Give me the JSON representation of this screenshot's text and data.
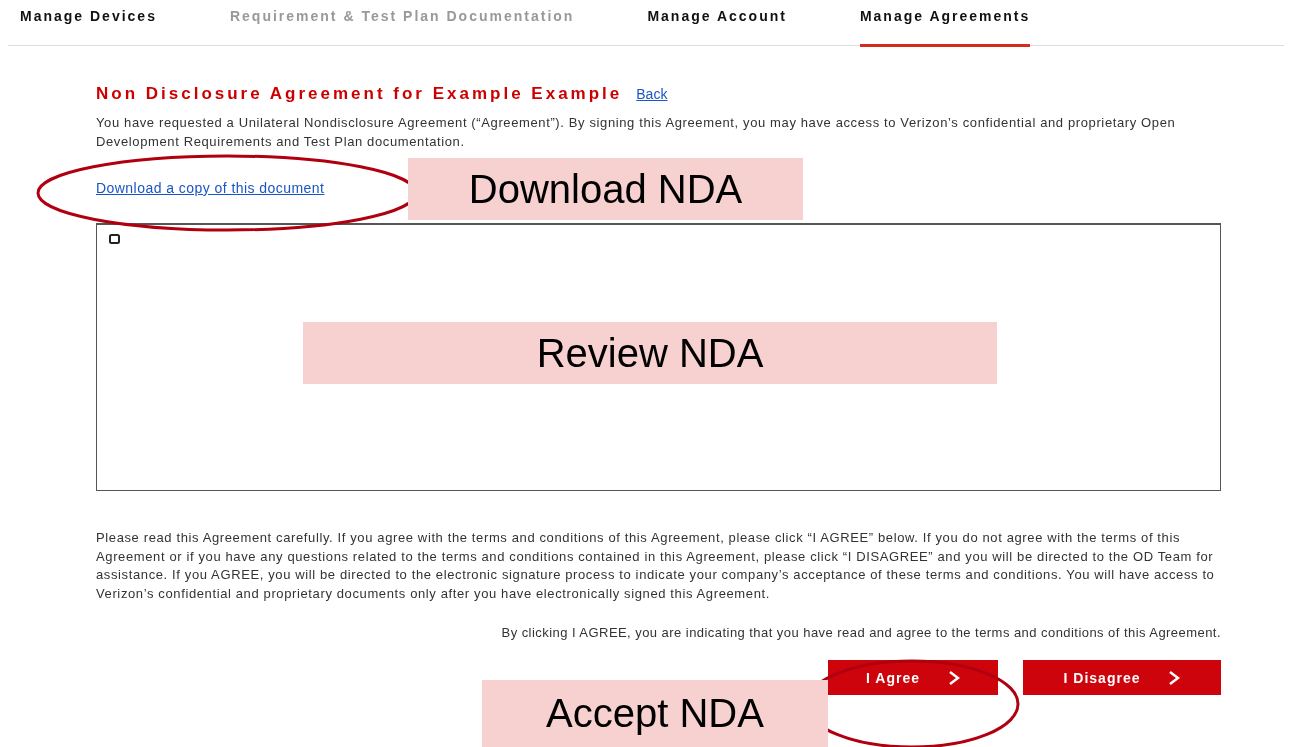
{
  "nav": {
    "tabs": [
      {
        "label": "Manage Devices",
        "selected": false,
        "disabled": false
      },
      {
        "label": "Requirement & Test Plan Documentation",
        "selected": false,
        "disabled": true
      },
      {
        "label": "Manage Account",
        "selected": false,
        "disabled": false
      },
      {
        "label": "Manage Agreements",
        "selected": true,
        "disabled": false
      }
    ]
  },
  "agreement": {
    "title": "Non Disclosure Agreement for Example Example",
    "back_link": "Back",
    "intro": "You have requested a Unilateral Nondisclosure Agreement (“Agreement”). By signing this Agreement, you may have access to Verizon’s confidential and proprietary Open Development Requirements and Test Plan documentation.",
    "download_link": "Download a copy of this document",
    "instructions": "Please read this Agreement carefully. If you agree with the terms and conditions of this Agreement, please click “I AGREE” below. If you do not agree with the terms of this Agreement or if you have any questions related to the terms and conditions contained in this Agreement, please click “I DISAGREE” and you will be directed to the OD Team for assistance. If you AGREE, you will be directed to the electronic signature process to indicate your company’s acceptance of these terms and conditions. You will have access to Verizon’s confidential and proprietary documents only after you have electronically signed this Agreement.",
    "confirmation": "By clicking I AGREE, you are indicating that you have read and agree to the terms and conditions of this Agreement.",
    "buttons": [
      {
        "label": "I Agree"
      },
      {
        "label": "I Disagree"
      }
    ]
  },
  "annotations": [
    {
      "text": "Download NDA"
    },
    {
      "text": "Review NDA"
    },
    {
      "text": "Accept NDA"
    }
  ]
}
